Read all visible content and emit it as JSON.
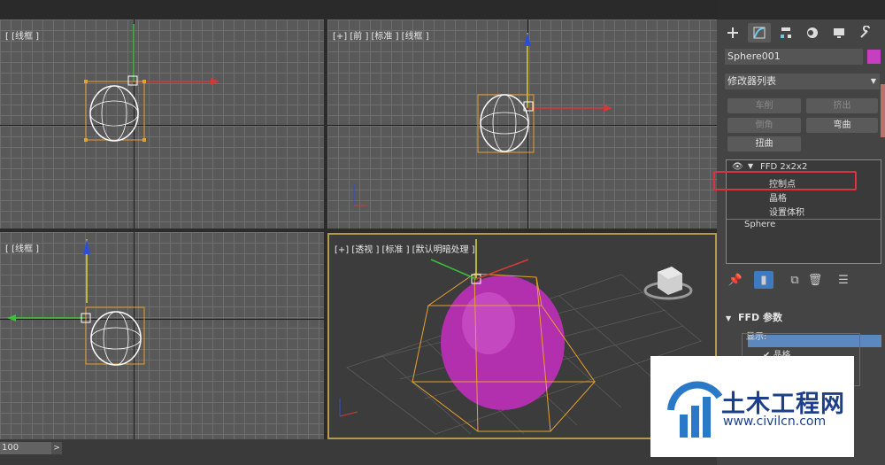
{
  "viewports": {
    "top": {
      "label": "[ [线框 ]"
    },
    "front": {
      "label": "[+] [前 ] [标准 ] [线框 ]"
    },
    "left": {
      "label": "[ [线框 ]"
    },
    "perspective": {
      "label": "[+] [透视 ] [标准 ] [默认明暗处理 ]"
    }
  },
  "timeline": {
    "frame_value": "100",
    "next_label": ">"
  },
  "command_panel": {
    "tabs": [
      {
        "icon": "create-plus-icon",
        "active": false
      },
      {
        "icon": "modify-icon",
        "active": true
      },
      {
        "icon": "hierarchy-icon",
        "active": false
      },
      {
        "icon": "motion-icon",
        "active": false
      },
      {
        "icon": "display-icon",
        "active": false
      },
      {
        "icon": "utilities-wrench-icon",
        "active": false
      }
    ],
    "object_name": "Sphere001",
    "object_color": "#c63fc1",
    "modifier_list": "修改器列表",
    "buttons": {
      "lathe": "车削",
      "extrude": "挤出",
      "chamfer": "倒角",
      "bend": "弯曲",
      "twist": "扭曲"
    },
    "stack": {
      "modifier": "FFD 2x2x2",
      "sub_control_points": "控制点",
      "sub_lattice": "晶格",
      "sub_set_volume": "设置体积",
      "base": "Sphere"
    },
    "rollout": {
      "title": "FFD 参数",
      "display_group": "显示:",
      "lattice_checkbox": "晶格"
    }
  },
  "watermark": {
    "name": "土木工程网",
    "url": "www.civilcn.com"
  }
}
